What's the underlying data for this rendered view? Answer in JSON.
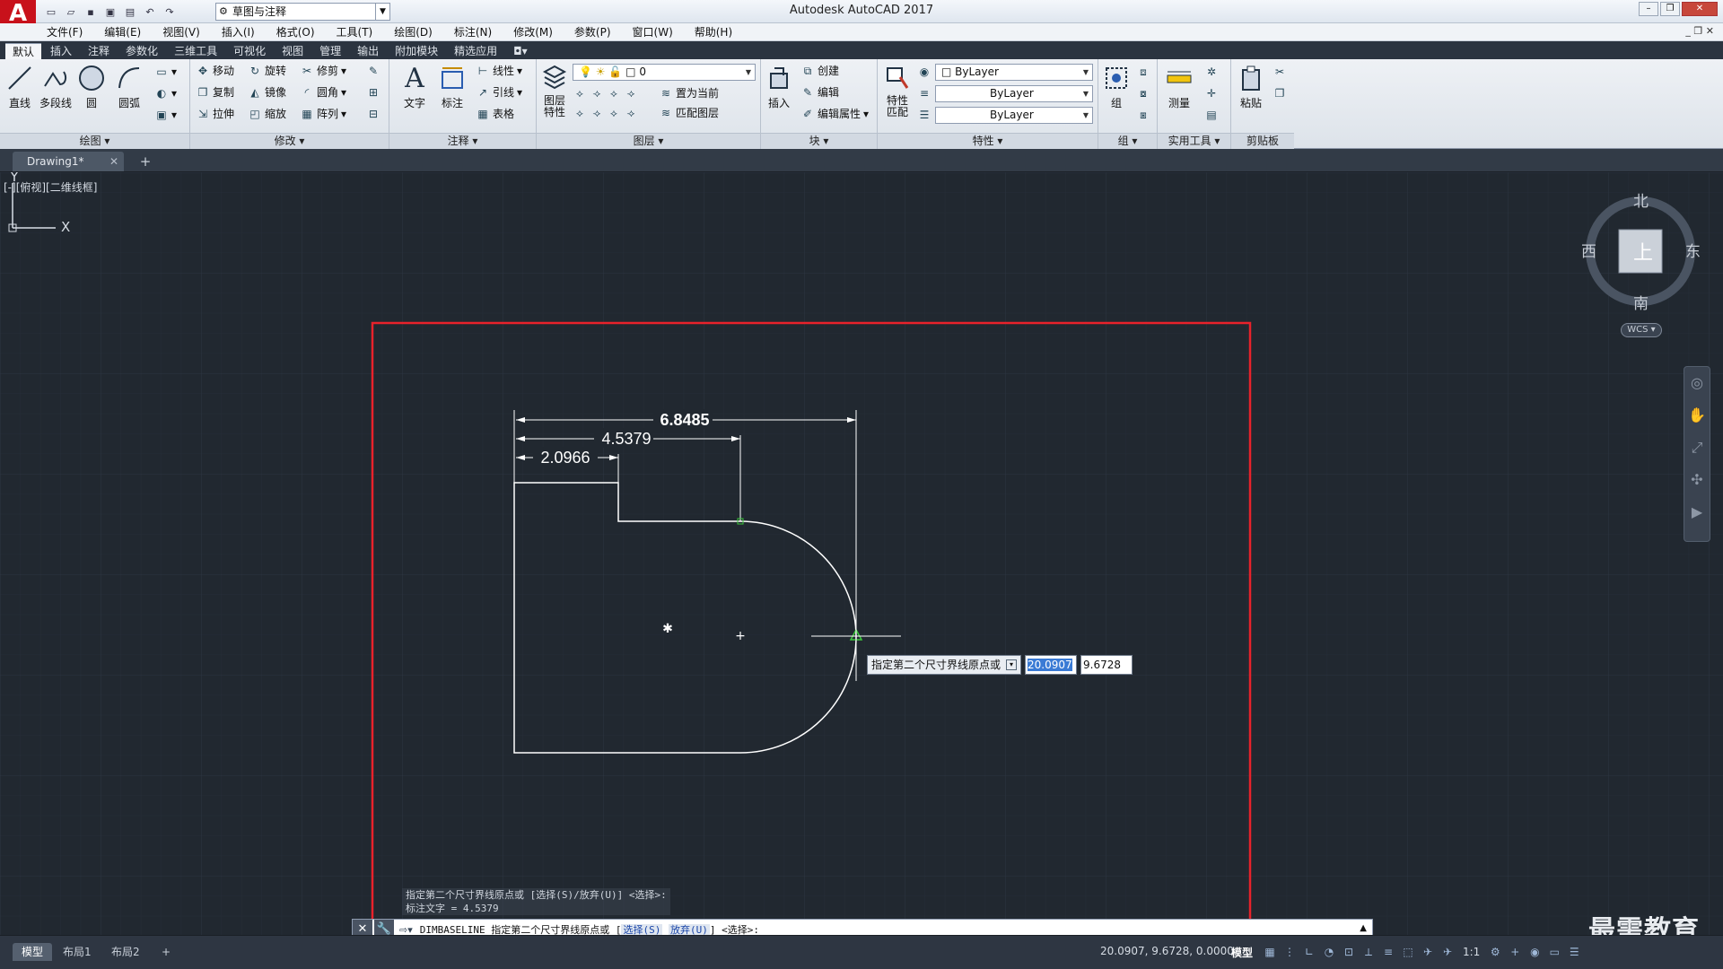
{
  "app": {
    "title": "Autodesk AutoCAD 2017",
    "logo_letter": "A",
    "workspace": "草图与注释"
  },
  "menu": [
    "文件(F)",
    "编辑(E)",
    "视图(V)",
    "插入(I)",
    "格式(O)",
    "工具(T)",
    "绘图(D)",
    "标注(N)",
    "修改(M)",
    "参数(P)",
    "窗口(W)",
    "帮助(H)"
  ],
  "ribbon_tabs": [
    "默认",
    "插入",
    "注释",
    "参数化",
    "三维工具",
    "可视化",
    "视图",
    "管理",
    "输出",
    "附加模块",
    "精选应用"
  ],
  "ribbon": {
    "draw": {
      "title": "绘图",
      "line": "直线",
      "polyline": "多段线",
      "circle": "圆",
      "arc": "圆弧"
    },
    "modify": {
      "title": "修改",
      "move": "移动",
      "rotate": "旋转",
      "trim": "修剪",
      "copy": "复制",
      "mirror": "镜像",
      "fillet": "圆角",
      "stretch": "拉伸",
      "scale": "缩放",
      "array": "阵列"
    },
    "annotation": {
      "title": "注释",
      "text": "文字",
      "dimension": "标注",
      "linear": "线性",
      "leader": "引线",
      "table": "表格"
    },
    "layers": {
      "title": "图层",
      "layer_props": "图层特性",
      "current_layer": "0",
      "make_current": "置为当前",
      "match_layer": "匹配图层"
    },
    "block": {
      "title": "块",
      "insert": "插入",
      "create": "创建",
      "edit": "编辑",
      "edit_attr": "编辑属性"
    },
    "properties": {
      "title": "特性",
      "match": "特性匹配",
      "color": "ByLayer",
      "linetype": "ByLayer",
      "lineweight": "ByLayer"
    },
    "groups": {
      "title": "组",
      "group": "组"
    },
    "utilities": {
      "title": "实用工具",
      "measure": "测量"
    },
    "clipboard": {
      "title": "剪贴板",
      "paste": "粘贴"
    }
  },
  "file_tab": {
    "name": "Drawing1*"
  },
  "viewport_label": "[-][俯视][二维线框]",
  "dimensions": {
    "d1": "6.8485",
    "d2": "4.5379",
    "d3": "2.0966"
  },
  "dynamic_input": {
    "prompt": "指定第二个尺寸界线原点或",
    "x": "20.0907",
    "y": "9.6728"
  },
  "viewcube": {
    "north": "北",
    "south": "南",
    "east": "东",
    "west": "西",
    "top": "上",
    "wcs": "WCS"
  },
  "ucs": {
    "x": "X",
    "y": "Y"
  },
  "command_history": [
    "指定第二个尺寸界线原点或 [选择(S)/放弃(U)] <选择>:",
    "标注文字 = 4.5379"
  ],
  "command_line": {
    "prefix": "DIMBASELINE 指定第二个尺寸界线原点或 [",
    "opt1": "选择(S)",
    "sep": " ",
    "opt2": "放弃(U)",
    "suffix": "] <选择>:"
  },
  "layout_tabs": [
    "模型",
    "布局1",
    "布局2"
  ],
  "status": {
    "coords": "20.0907, 9.6728, 0.0000",
    "model": "模型",
    "scale": "1:1"
  },
  "watermark": "最需教育",
  "colors": {
    "canvas": "#212830",
    "highlight": "#e8222b",
    "geometry": "#ffffff",
    "grip": "#3cc83c"
  }
}
